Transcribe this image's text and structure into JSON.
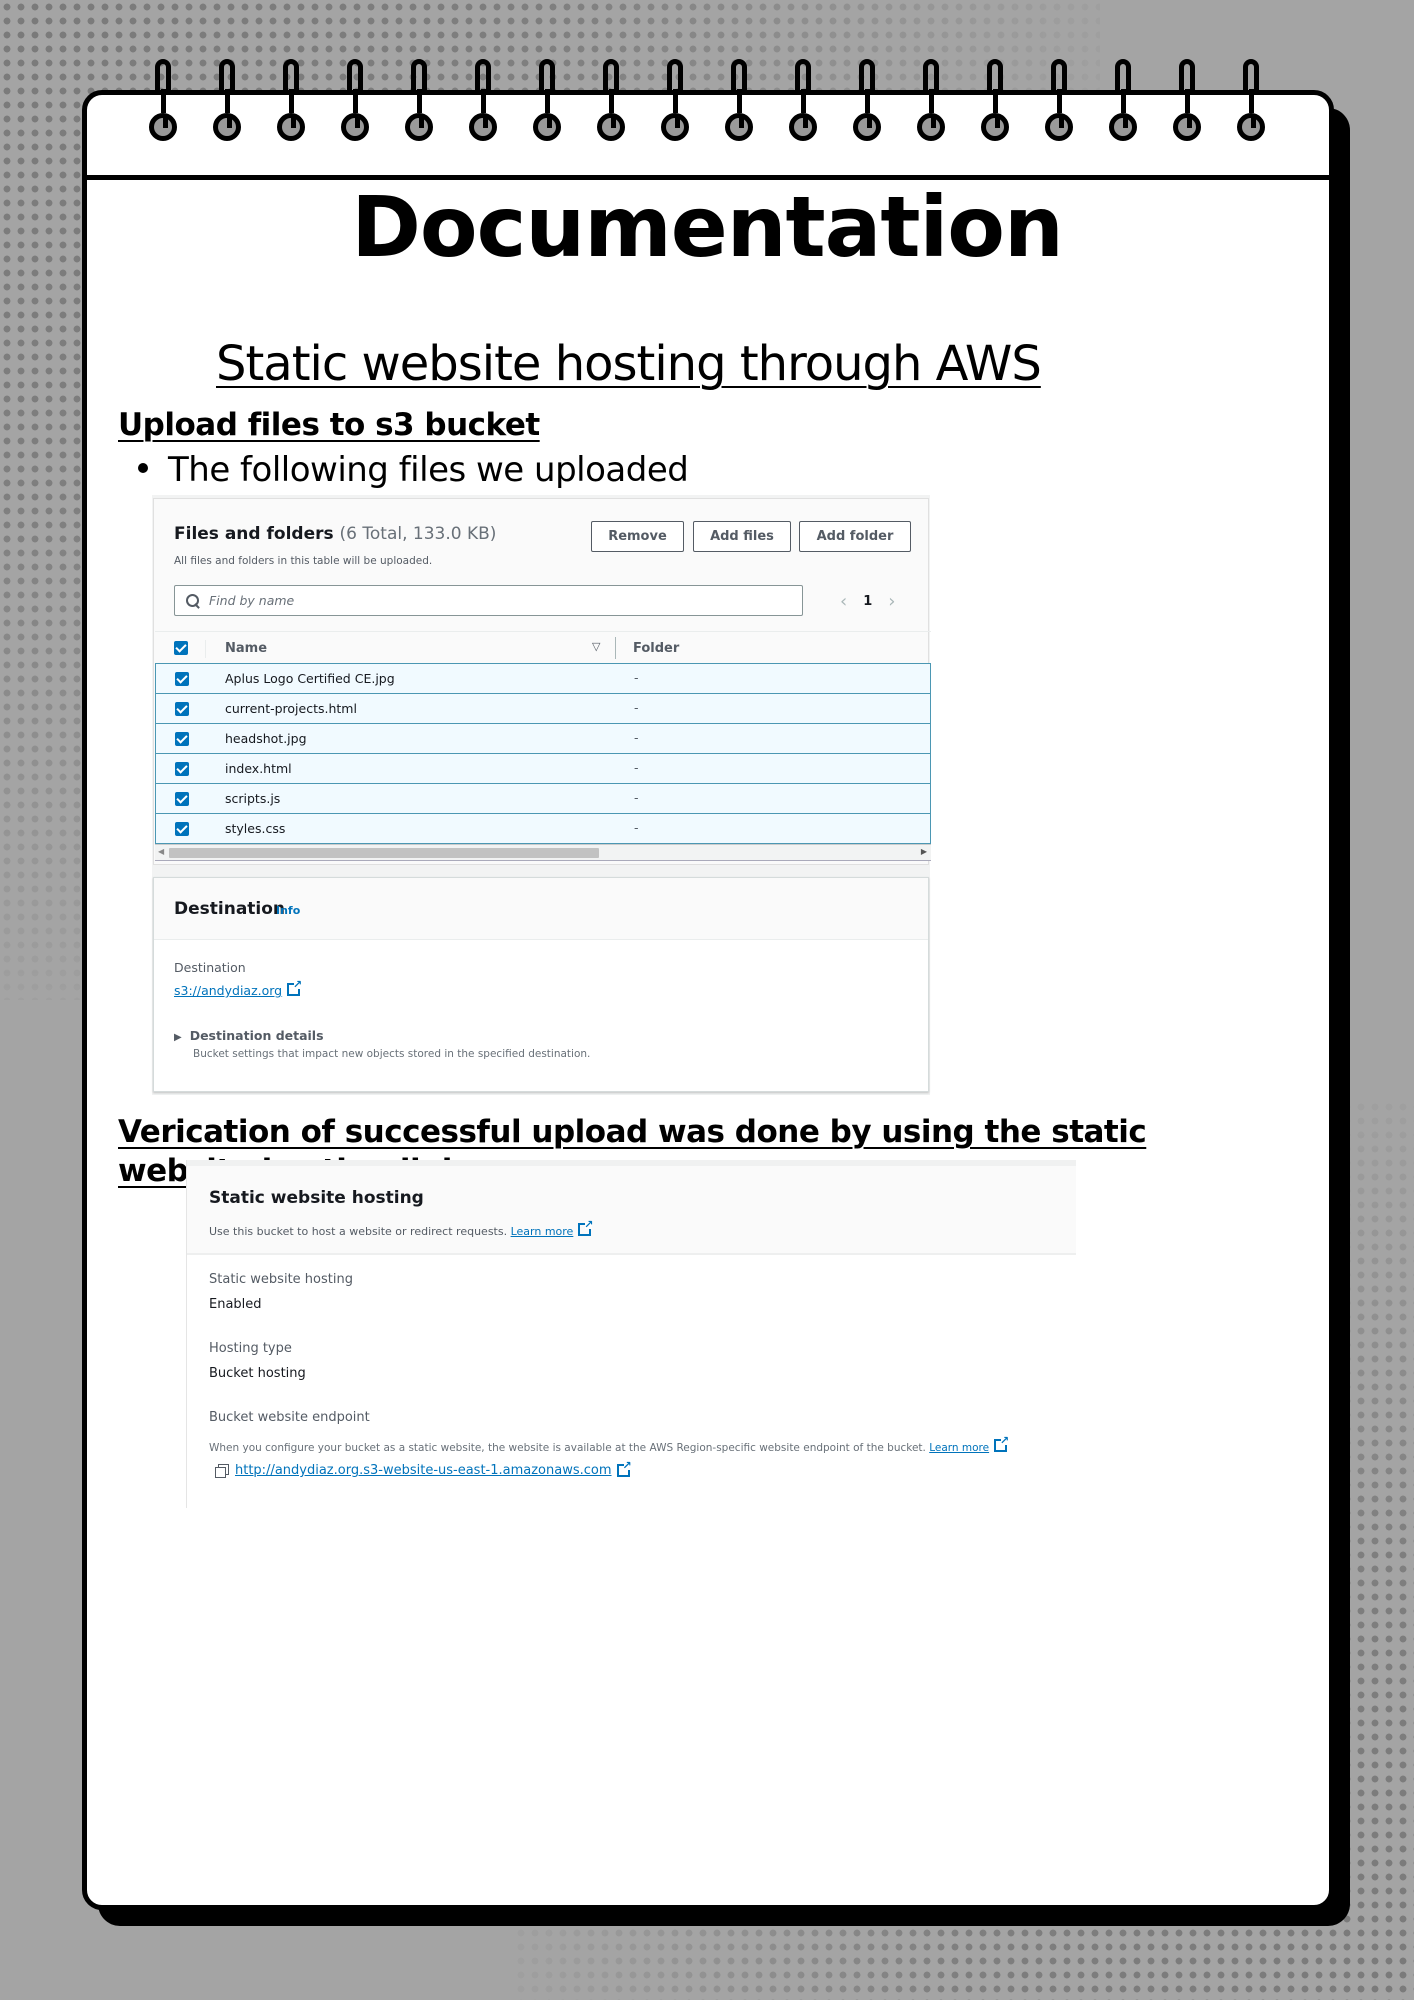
{
  "document": {
    "title": "Documentation",
    "subtitle": "Static website hosting  through  AWS",
    "section1_heading": "Upload files  to s3 bucket ",
    "bullet_text": "The following files we uploaded",
    "section2_heading": "Verication of successful upload was done by using the static website hosting link "
  },
  "upload_panel": {
    "title": "Files and folders",
    "count_label": "(6 Total, 133.0 KB)",
    "description": "All files and folders in this table will be uploaded.",
    "buttons": {
      "remove": "Remove",
      "add_files": "Add files",
      "add_folder": "Add folder"
    },
    "search": {
      "placeholder": "Find by name",
      "value": ""
    },
    "pagination": {
      "current_page": "1",
      "prev_icon": "chevron-left-icon",
      "next_icon": "chevron-right-icon"
    },
    "table": {
      "columns": [
        "Name",
        "Folder"
      ],
      "select_all_checked": true,
      "rows": [
        {
          "name": "Aplus Logo Certified CE.jpg",
          "folder": "-",
          "checked": true
        },
        {
          "name": "current-projects.html",
          "folder": "-",
          "checked": true
        },
        {
          "name": "headshot.jpg",
          "folder": "-",
          "checked": true
        },
        {
          "name": "index.html",
          "folder": "-",
          "checked": true
        },
        {
          "name": "scripts.js",
          "folder": "-",
          "checked": true
        },
        {
          "name": "styles.css",
          "folder": "-",
          "checked": true
        }
      ]
    }
  },
  "destination_panel": {
    "title": "Destination",
    "info_link": "Info",
    "destination_label": "Destination",
    "destination_value": "s3://andydiaz.org",
    "details_label": "Destination details",
    "details_description": "Bucket settings that impact new objects stored in the specified destination."
  },
  "hosting_panel": {
    "title": "Static website hosting",
    "description": "Use this bucket to host a website or redirect requests.",
    "learn_more": "Learn more",
    "fields": [
      {
        "label": "Static website hosting",
        "value": "Enabled"
      },
      {
        "label": "Hosting type",
        "value": "Bucket hosting"
      }
    ],
    "endpoint_label": "Bucket website endpoint",
    "endpoint_description": "When you configure your bucket as a static website, the website is available at the AWS Region-specific website endpoint of the bucket.",
    "endpoint_learn_more": "Learn more",
    "endpoint_url": "http://andydiaz.org.s3-website-us-east-1.amazonaws.com"
  },
  "colors": {
    "aws_link": "#0073bb",
    "checkbox": "#0073bb",
    "selected_row_bg": "#f1faff",
    "selected_row_border": "#4b97b3",
    "background": "#a4a4a4"
  }
}
